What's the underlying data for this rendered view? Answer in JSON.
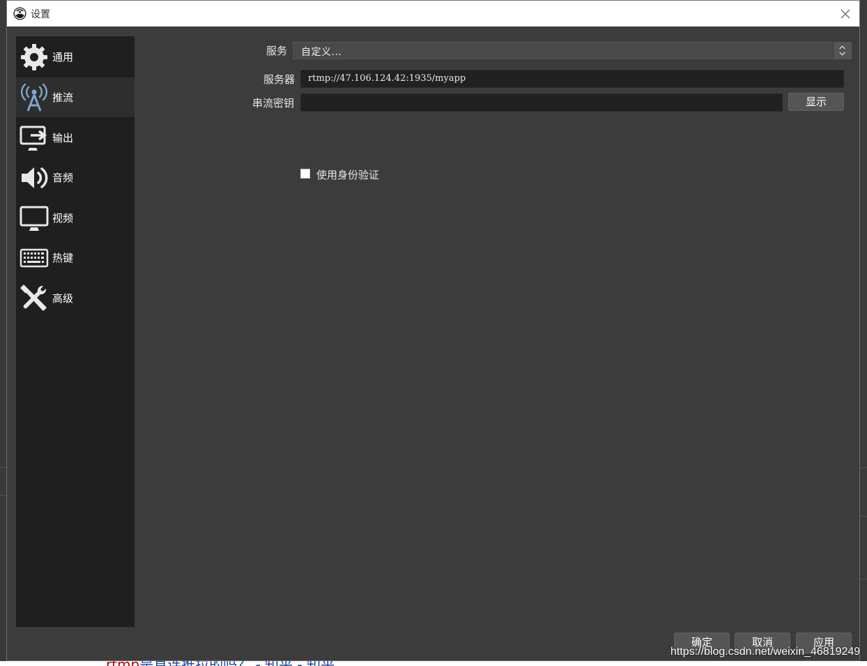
{
  "window": {
    "title": "设置",
    "close_icon": "close-icon"
  },
  "sidebar": {
    "items": [
      {
        "label": "通用",
        "icon": "gear-icon"
      },
      {
        "label": "推流",
        "icon": "broadcast-antenna-icon",
        "selected": true
      },
      {
        "label": "输出",
        "icon": "output-monitor-icon"
      },
      {
        "label": "音频",
        "icon": "speaker-icon"
      },
      {
        "label": "视频",
        "icon": "monitor-icon"
      },
      {
        "label": "热键",
        "icon": "keyboard-icon"
      },
      {
        "label": "高级",
        "icon": "tools-icon"
      }
    ]
  },
  "stream": {
    "service_label": "服务",
    "service_value": "自定义...",
    "server_label": "服务器",
    "server_value": "rtmp://47.106.124.42:1935/myapp",
    "key_label": "串流密钥",
    "key_value": "",
    "show_button": "显示",
    "auth_checkbox_label": "使用身份验证",
    "auth_checked": false
  },
  "footer": {
    "ok_button": "确定",
    "cancel_button": "取消",
    "apply_button": "应用"
  },
  "watermark": "https://blog.csdn.net/weixin_46819249",
  "background_fragment": {
    "red": "rtmp",
    "blue": "是直连推拉的吗？ - 知乎 - 知乎"
  },
  "colors": {
    "sidebar_bg": "#1f1f1f",
    "selected_bg": "#2e2e2e",
    "panel_bg": "#3c3c3c",
    "input_bg": "#212121",
    "button_bg": "#555555",
    "icon_accent": "#7fa7d0"
  }
}
